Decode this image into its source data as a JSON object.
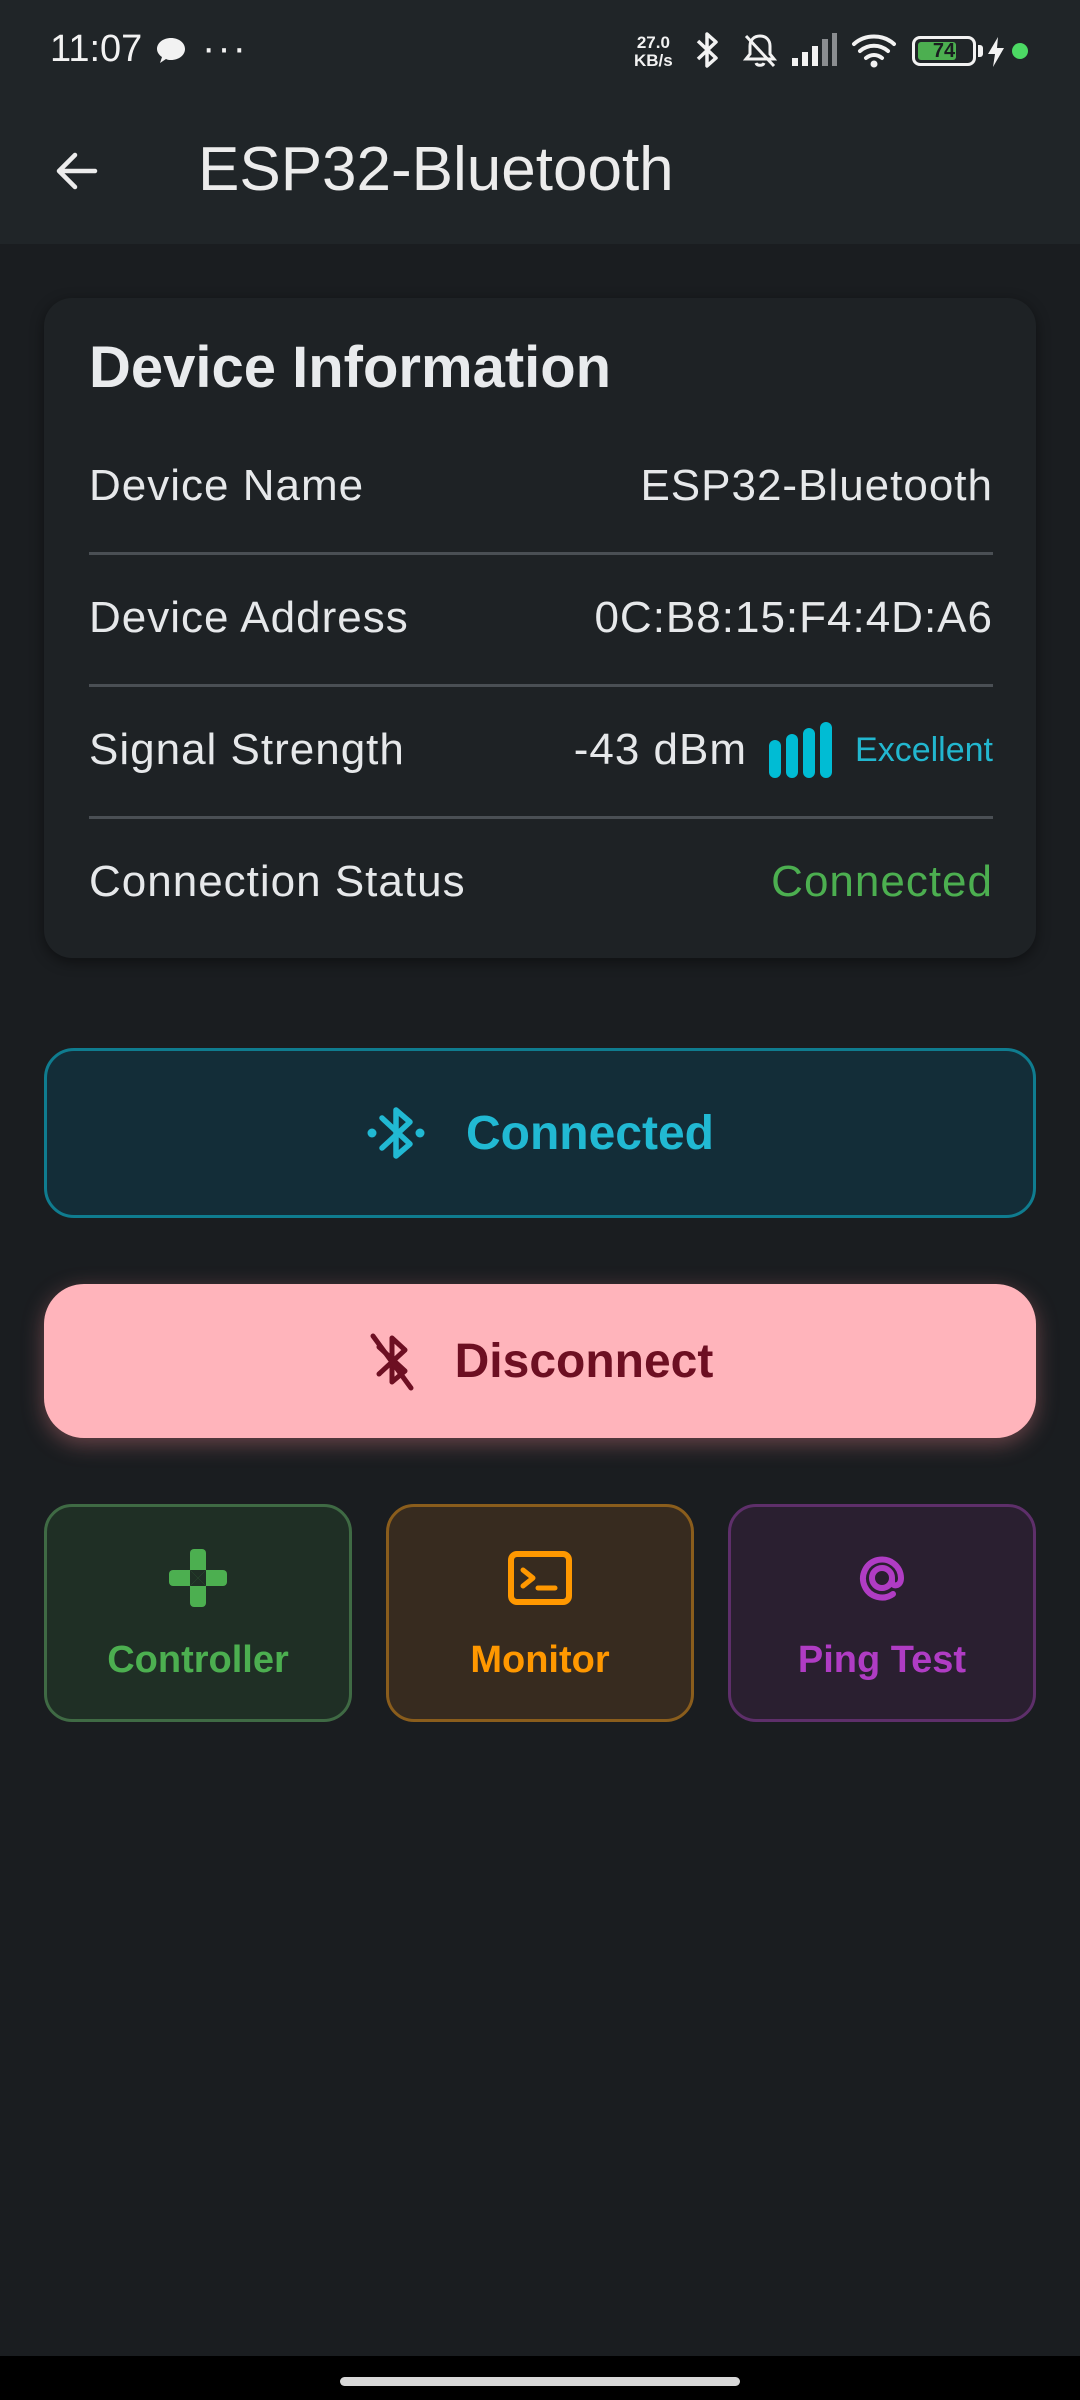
{
  "status_bar": {
    "time": "11:07",
    "network_speed_value": "27.0",
    "network_speed_unit": "KB/s",
    "battery_level": "74",
    "battery_fraction": 0.74,
    "icons": [
      "chat-bubble-icon",
      "more-dots-icon",
      "bluetooth-icon",
      "bell-muted-icon",
      "cellular-signal-icon",
      "wifi-icon",
      "battery-icon",
      "charging-bolt-icon",
      "privacy-indicator-dot"
    ]
  },
  "app_bar": {
    "back_icon": "arrow-left-icon",
    "title": "ESP32-Bluetooth"
  },
  "device_info": {
    "title": "Device Information",
    "rows": [
      {
        "label": "Device Name",
        "value": "ESP32-Bluetooth"
      },
      {
        "label": "Device Address",
        "value": "0C:B8:15:F4:4D:A6"
      },
      {
        "label": "Signal Strength",
        "value": "-43 dBm",
        "quality": "Excellent",
        "bars_filled": 4,
        "bars_total": 4
      },
      {
        "label": "Connection Status",
        "value": "Connected"
      }
    ]
  },
  "connection_button": {
    "label": "Connected",
    "icon": "bluetooth-connected-icon"
  },
  "disconnect_button": {
    "label": "Disconnect",
    "icon": "bluetooth-disabled-icon"
  },
  "tiles": [
    {
      "label": "Controller",
      "icon": "gamepad-icon"
    },
    {
      "label": "Monitor",
      "icon": "terminal-icon"
    },
    {
      "label": "Ping Test",
      "icon": "at-sign-icon"
    }
  ],
  "colors": {
    "background": "#1a1d20",
    "card": "#1e2225",
    "accent_cyan": "#00bcd4",
    "connected_green": "#4caf50",
    "disconnect_pink": "#ffb4bb",
    "monitor_orange": "#ff9800",
    "ping_purple": "#b03cc4"
  }
}
